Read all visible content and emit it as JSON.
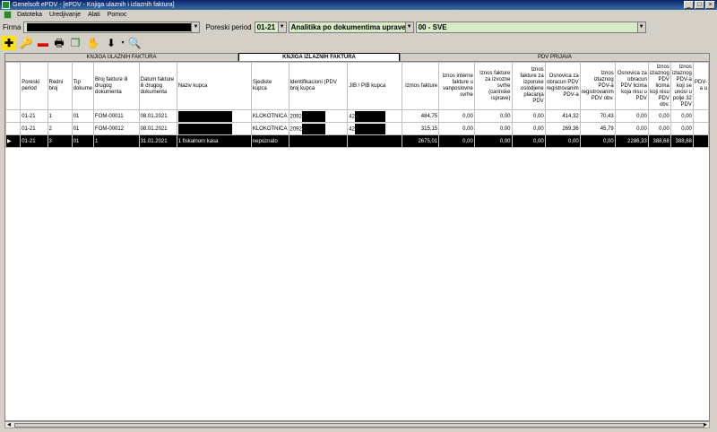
{
  "window": {
    "title": "Genelsoft ePDV - [ePDV - Knjiga ulaznih i izlaznih faktura]"
  },
  "menu": [
    "Datoteka",
    "Uredjivanje",
    "Alati",
    "Pomoc"
  ],
  "filters": {
    "firma_label": "Firma",
    "period_label": "Poreski period",
    "period_value": "01-21",
    "analysis_value": "Analitika po dokumentima uprave",
    "category_value": "00 - SVE"
  },
  "toolbar": [
    {
      "name": "add-icon",
      "glyph": "✚"
    },
    {
      "name": "key-icon",
      "glyph": "🔑"
    },
    {
      "name": "delete-icon",
      "glyph": "▬"
    },
    {
      "name": "print-icon",
      "glyph": "🖶"
    },
    {
      "name": "copy-icon",
      "glyph": "❐"
    },
    {
      "name": "handshake-icon",
      "glyph": "✋"
    },
    {
      "name": "arrow-down-icon",
      "glyph": "⬇"
    },
    {
      "name": "search-icon",
      "glyph": "🔍"
    }
  ],
  "tabs": [
    "KNJIGA ULAZNIH FAKTURA",
    "KNJIGA IZLAZNIH FAKTURA",
    "PDV PRIJAVA"
  ],
  "table": {
    "columns": [
      "Poreski period",
      "Redni broj",
      "Tip dokume",
      "Broj fakture ili drugog dokumenta",
      "Datum fakture ili drugog dokumenta",
      "Naziv kupca",
      "Sjediste kupca",
      "Identifikacioni (PDV broj kupca",
      "JIB / PIB kupca",
      "Izmos fakture",
      "Iznos interne fakture u vanposlovne svrhe",
      "Iznos fakture za izvozne svrhe (carinske isprave)",
      "Iznos fakture za izporuke oslodjene placanja PDV",
      "Osnovica za obracun PDV registrovanim PDV-a",
      "Iznos izlaznog PDV-a registrovanim PDV obv.",
      "Osnovica za obracun PDV licima koja nisu u PDV",
      "Iznos izlaznog PDV licima koji nisu PDV obv.",
      "Iznos izlaznog PDV-a koji se unosi u polje 32 PDV",
      "PDV-a u"
    ],
    "rows": [
      {
        "cells": [
          "01-21",
          "1",
          "01",
          "FOM-00011",
          "08.01.2021",
          "",
          "KLOKOTNICA",
          "2092",
          "42",
          "484,75",
          "0,00",
          "0,00",
          "0,00",
          "414,32",
          "70,43",
          "0,00",
          "0,00",
          "0,00",
          ""
        ]
      },
      {
        "cells": [
          "01-21",
          "2",
          "01",
          "FOM-00012",
          "08.01.2021",
          "",
          "KLOKOTNICA",
          "2092",
          "42",
          "315,15",
          "0,00",
          "0,00",
          "0,00",
          "269,36",
          "45,79",
          "0,00",
          "0,00",
          "0,00",
          ""
        ]
      },
      {
        "cells": [
          "01-21",
          "3",
          "01",
          "1",
          "31.01.2021",
          "1 fiskalnom kasa",
          "nepoznato",
          "",
          "",
          "2675,01",
          "0,00",
          "0,00",
          "0,00",
          "0,00",
          "0,00",
          "2286,33",
          "388,68",
          "388,68",
          ""
        ]
      }
    ]
  }
}
